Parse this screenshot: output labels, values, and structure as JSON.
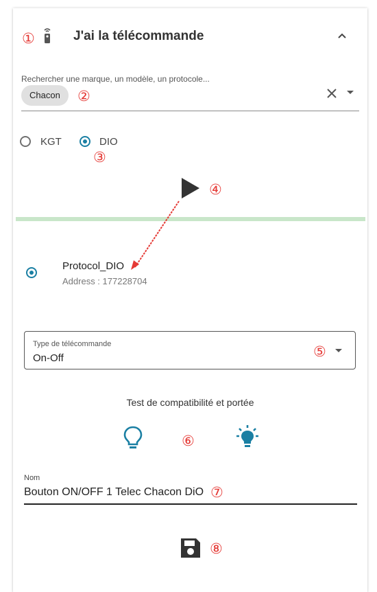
{
  "annotations": {
    "n1": "①",
    "n2": "②",
    "n3": "③",
    "n4": "④",
    "n5": "⑤",
    "n6": "⑥",
    "n7": "⑦",
    "n8": "⑧"
  },
  "header": {
    "title": "J'ai la télécommande",
    "remote_icon": "remote-icon",
    "collapse_icon": "chevron-up-icon"
  },
  "search": {
    "label": "Rechercher une marque, un modèle, un protocole...",
    "chip": "Chacon",
    "clear_icon": "close-icon",
    "dropdown_icon": "caret-down-icon"
  },
  "radios": [
    {
      "label": "KGT",
      "selected": false
    },
    {
      "label": "DIO",
      "selected": true
    }
  ],
  "play_icon": "play-icon",
  "progress": {
    "value": 1.0,
    "color": "#c8e6c9"
  },
  "protocol": {
    "name": "Protocol_DIO",
    "address": "Address : 177228704",
    "selected": true
  },
  "remote_type": {
    "label": "Type de télécommande",
    "value": "On-Off"
  },
  "test": {
    "title": "Test de compatibilité et portée",
    "off_icon": "lightbulb-off-icon",
    "on_icon": "lightbulb-on-icon"
  },
  "name_field": {
    "label": "Nom",
    "value": "Bouton ON/OFF 1 Telec Chacon DiO"
  },
  "save_icon": "save-icon",
  "colors": {
    "accent": "#1a7fa3",
    "annotation": "#e53935",
    "progress": "#c8e6c9"
  }
}
